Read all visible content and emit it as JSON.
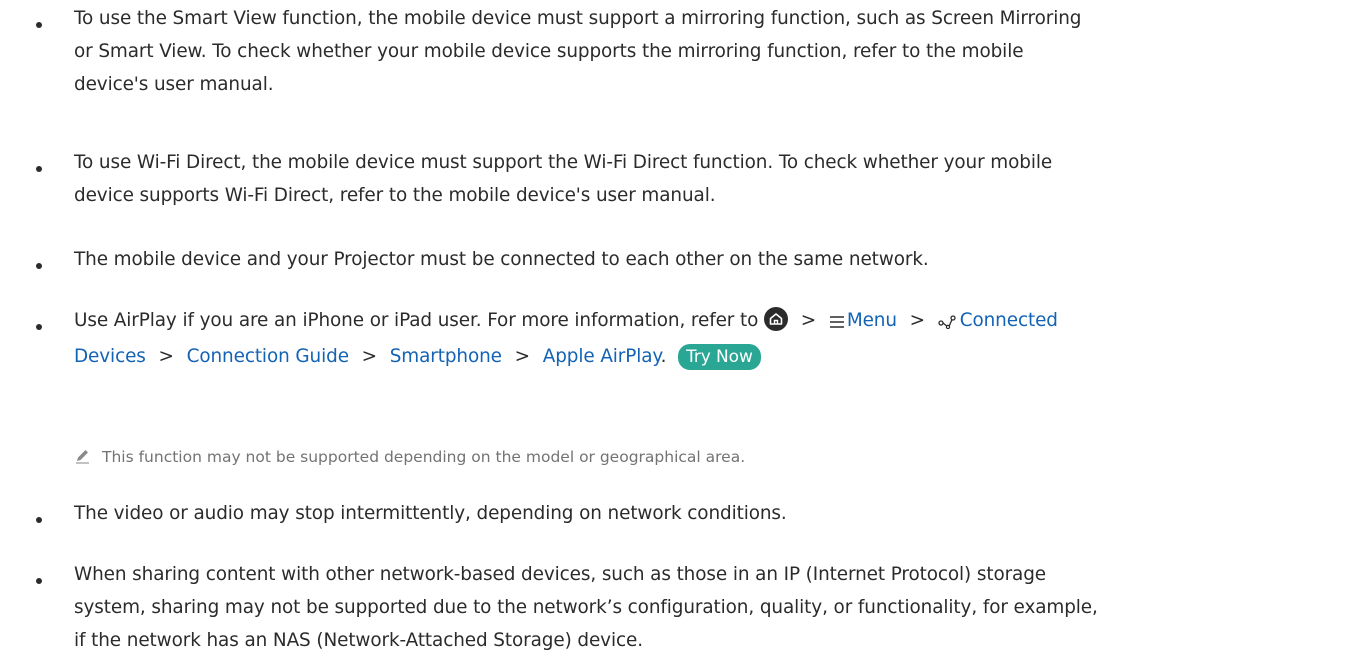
{
  "bullets": [
    {
      "lines": [
        "To use the Smart View function, the mobile device must support a mirroring function, such as Screen Mirroring",
        "or Smart View. To check whether your mobile device supports the mirroring function, refer to the mobile",
        "device's user manual."
      ]
    },
    {
      "lines": [
        "To use Wi-Fi Direct, the mobile device must support the Wi-Fi Direct function. To check whether your mobile",
        "device supports Wi-Fi Direct, refer to the mobile device's user manual."
      ]
    },
    {
      "lines": [
        "The mobile device and your Projector must be connected to each other on the same network."
      ]
    },
    {
      "intro": "Use AirPlay if you are an iPhone or iPad user. For more information, refer to",
      "path": {
        "sep": ">",
        "menu": "Menu",
        "connected_devices_1": "Connected",
        "connected_devices_2": "Devices",
        "connection_guide": "Connection Guide",
        "smartphone": "Smartphone",
        "apple_airplay": "Apple AirPlay",
        "period": "."
      },
      "try_now": "Try Now",
      "note": "This function may not be supported depending on the model or geographical area."
    },
    {
      "lines": [
        "The video or audio may stop intermittently, depending on network conditions."
      ]
    },
    {
      "lines": [
        "When sharing content with other network-based devices, such as those in an IP (Internet Protocol) storage",
        "system, sharing may not be supported due to the network’s configuration, quality, or functionality, for example,",
        "if the network has an NAS (Network-Attached Storage) device."
      ]
    }
  ],
  "colors": {
    "link": "#1363b5",
    "button": "#2aa694",
    "note": "#737373"
  },
  "icons": [
    "home-icon",
    "menu-icon",
    "connected-devices-icon",
    "pencil-icon"
  ]
}
